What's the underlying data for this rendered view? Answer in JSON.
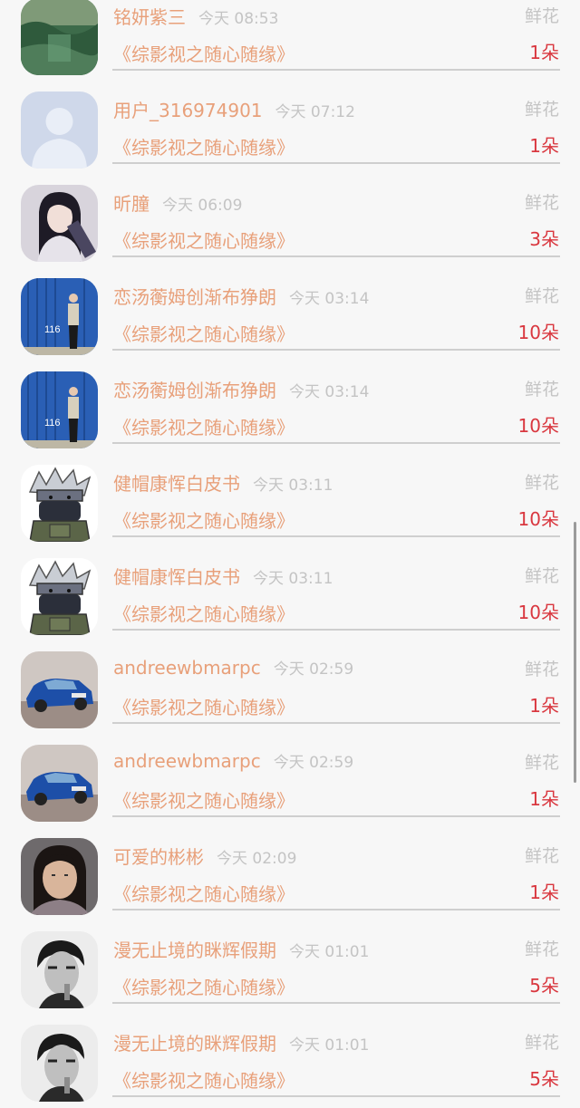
{
  "rows": [
    {
      "user": "铭妍紫三",
      "time": "今天 08:53",
      "gift": "鲜花",
      "novel": "《综影视之随心随缘》",
      "qty": "1朵",
      "avatar": "landscape-photo"
    },
    {
      "user": "用户_316974901",
      "time": "今天 07:12",
      "gift": "鲜花",
      "novel": "《综影视之随心随缘》",
      "qty": "1朵",
      "avatar": "default-user"
    },
    {
      "user": "昕朣",
      "time": "今天 06:09",
      "gift": "鲜花",
      "novel": "《综影视之随心随缘》",
      "qty": "3朵",
      "avatar": "anime-girl"
    },
    {
      "user": "恋汤蘅姆创渐布狰朗",
      "time": "今天 03:14",
      "gift": "鲜花",
      "novel": "《综影视之随心随缘》",
      "qty": "10朵",
      "avatar": "blue-container-person"
    },
    {
      "user": "恋汤蘅姆创渐布狰朗",
      "time": "今天 03:14",
      "gift": "鲜花",
      "novel": "《综影视之随心随缘》",
      "qty": "10朵",
      "avatar": "blue-container-person"
    },
    {
      "user": "健帽康恽白皮书",
      "time": "今天 03:11",
      "gift": "鲜花",
      "novel": "《综影视之随心随缘》",
      "qty": "10朵",
      "avatar": "ninja-cartoon"
    },
    {
      "user": "健帽康恽白皮书",
      "time": "今天 03:11",
      "gift": "鲜花",
      "novel": "《综影视之随心随缘》",
      "qty": "10朵",
      "avatar": "ninja-cartoon"
    },
    {
      "user": "andreewbmarpc",
      "time": "今天 02:59",
      "gift": "鲜花",
      "novel": "《综影视之随心随缘》",
      "qty": "1朵",
      "avatar": "blue-rally-car"
    },
    {
      "user": "andreewbmarpc",
      "time": "今天 02:59",
      "gift": "鲜花",
      "novel": "《综影视之随心随缘》",
      "qty": "1朵",
      "avatar": "blue-rally-car"
    },
    {
      "user": "可爱的彬彬",
      "time": "今天 02:09",
      "gift": "鲜花",
      "novel": "《综影视之随心随缘》",
      "qty": "1朵",
      "avatar": "girl-photo"
    },
    {
      "user": "漫无止境的眯辉假期",
      "time": "今天 01:01",
      "gift": "鲜花",
      "novel": "《综影视之随心随缘》",
      "qty": "5朵",
      "avatar": "bw-man-photo"
    },
    {
      "user": "漫无止境的眯辉假期",
      "time": "今天 01:01",
      "gift": "鲜花",
      "novel": "《综影视之随心随缘》",
      "qty": "5朵",
      "avatar": "bw-man-photo"
    }
  ]
}
